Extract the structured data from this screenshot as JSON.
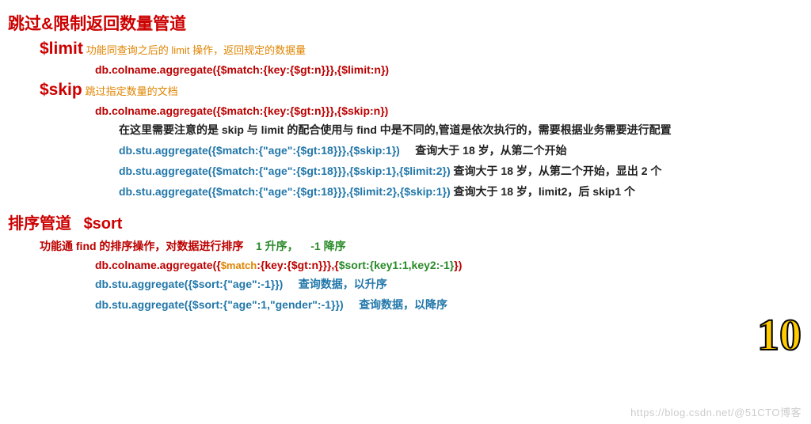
{
  "section1": {
    "title": "跳过&限制返回数量管道",
    "limit": {
      "kw": "$limit",
      "desc": "功能同查询之后的 limit 操作，返回规定的数据量",
      "code": "db.colname.aggregate({$match:{key:{$gt:n}}},{$limit:n})"
    },
    "skip": {
      "kw": "$skip",
      "desc": "跳过指定数量的文档",
      "code": "db.colname.aggregate({$match:{key:{$gt:n}}},{$skip:n})",
      "note": "在这里需要注意的是 skip 与 limit 的配合使用与 find 中是不同的,管道是依次执行的，需要根据业务需要进行配置",
      "ex1code": "db.stu.aggregate({$match:{\"age\":{$gt:18}}},{$skip:1})",
      "ex1text": "查询大于 18 岁，从第二个开始",
      "ex2code": "db.stu.aggregate({$match:{\"age\":{$gt:18}}},{$skip:1},{$limit:2})",
      "ex2text": "查询大于 18 岁，从第二个开始，显出 2 个",
      "ex3code": "db.stu.aggregate({$match:{\"age\":{$gt:18}}},{$limit:2},{$skip:1})",
      "ex3text": "查询大于 18 岁，limit2，后 skip1 个"
    }
  },
  "section2": {
    "title_a": "排序管道",
    "title_b": "$sort",
    "desc_a": "功能通 find 的排序操作，对数据进行排序",
    "desc_b": "1 升序，",
    "desc_c": "-1 降序",
    "code_pre": "db.colname.aggregate({",
    "code_match": "$match",
    "code_mid": ":{key:{$gt:n}}},{",
    "code_sort": "$sort:{key1:1,key2:-1}",
    "code_end": "})",
    "ex1code": "db.stu.aggregate({$sort:{\"age\":-1}})",
    "ex1text": "查询数据，以升序",
    "ex2code": "db.stu.aggregate({$sort:{\"age\":1,\"gender\":-1}})",
    "ex2text": "查询数据，以降序"
  },
  "watermark": "https://blog.csdn.net/@51CTO博客",
  "pagemark": "10"
}
